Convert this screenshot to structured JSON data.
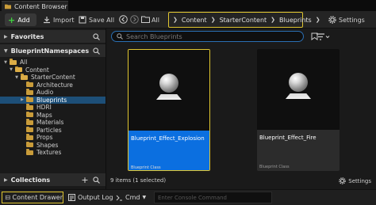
{
  "tab": {
    "title": "Content Browser"
  },
  "toolbar": {
    "add_label": "Add",
    "import_label": "Import",
    "save_all_label": "Save All",
    "all_label": "All",
    "settings_label": "Settings"
  },
  "breadcrumb": {
    "items": [
      "Content",
      "StarterContent",
      "Blueprints"
    ]
  },
  "left": {
    "favorites_label": "Favorites",
    "namespaces_label": "BlueprintNamespaces",
    "collections_label": "Collections",
    "tree": [
      {
        "label": "All",
        "depth": 0,
        "open": true,
        "selected": false
      },
      {
        "label": "Content",
        "depth": 1,
        "open": true,
        "selected": false
      },
      {
        "label": "StarterContent",
        "depth": 2,
        "open": true,
        "selected": false
      },
      {
        "label": "Architecture",
        "depth": 3,
        "open": false,
        "selected": false
      },
      {
        "label": "Audio",
        "depth": 3,
        "open": false,
        "selected": false
      },
      {
        "label": "Blueprints",
        "depth": 3,
        "open": false,
        "selected": true
      },
      {
        "label": "HDRI",
        "depth": 3,
        "open": false,
        "selected": false
      },
      {
        "label": "Maps",
        "depth": 3,
        "open": false,
        "selected": false
      },
      {
        "label": "Materials",
        "depth": 3,
        "open": false,
        "selected": false
      },
      {
        "label": "Particles",
        "depth": 3,
        "open": false,
        "selected": false
      },
      {
        "label": "Props",
        "depth": 3,
        "open": false,
        "selected": false
      },
      {
        "label": "Shapes",
        "depth": 3,
        "open": false,
        "selected": false
      },
      {
        "label": "Textures",
        "depth": 3,
        "open": false,
        "selected": false
      }
    ]
  },
  "main": {
    "search_placeholder": "Search Blueprints",
    "assets": [
      {
        "name": "Blueprint_Effect_Explosion",
        "class": "Blueprint Class"
      },
      {
        "name": "Blueprint_Effect_Fire",
        "class": "Blueprint Class"
      }
    ],
    "item_count": "9 items (1 selected)",
    "settings_label": "Settings"
  },
  "statusbar": {
    "content_drawer_label": "Content Drawer",
    "output_log_label": "Output Log",
    "cmd_label": "Cmd",
    "console_placeholder": "Enter Console Command"
  },
  "colors": {
    "accent_yellow": "#e0c630",
    "selection_blue": "#0b6fe0",
    "tree_selected": "#1d4f78",
    "folder": "#c99c3a"
  }
}
